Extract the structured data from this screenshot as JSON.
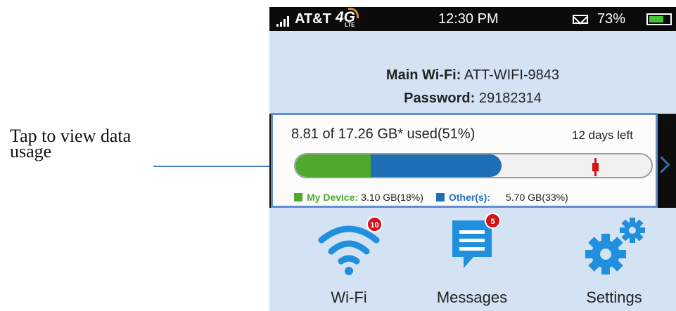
{
  "annotation": {
    "line1": "Tap to view data",
    "line2": "usage"
  },
  "status_bar": {
    "carrier": "AT&T",
    "network": "4G",
    "network_sub": "LTE",
    "time": "12:30 PM",
    "battery_percent": "73%",
    "battery_level": 0.73,
    "icons": [
      "signal-icon",
      "mail-icon",
      "battery-icon"
    ]
  },
  "wifi": {
    "main_label": "Main Wi-Fi:",
    "main_value": "ATT-WIFI-9843",
    "password_label": "Password:",
    "password_value": "29182314"
  },
  "usage": {
    "summary": "8.81 of 17.26 GB* used(51%)",
    "days_left": "12 days left",
    "my_device_fraction": 0.18,
    "others_fraction": 0.33,
    "marker_fraction": 0.84,
    "legend": {
      "my_device_label": "My Device:",
      "my_device_value": "3.10 GB(18%)",
      "others_label": "Other(s):",
      "others_value": "5.70 GB(33%)"
    },
    "colors": {
      "my_device": "#4ea92d",
      "others": "#1e6fb6",
      "marker": "#d4121a"
    }
  },
  "apps": [
    {
      "label": "Wi-Fi",
      "badge": "10",
      "icon": "wifi-icon"
    },
    {
      "label": "Messages",
      "badge": "5",
      "icon": "messages-icon"
    },
    {
      "label": "Settings",
      "badge": "",
      "icon": "settings-gear-icon"
    }
  ],
  "colors": {
    "accent": "#2f6db5",
    "screen_background": "#d3e3f3",
    "icon_blue": "#1f8fde"
  }
}
